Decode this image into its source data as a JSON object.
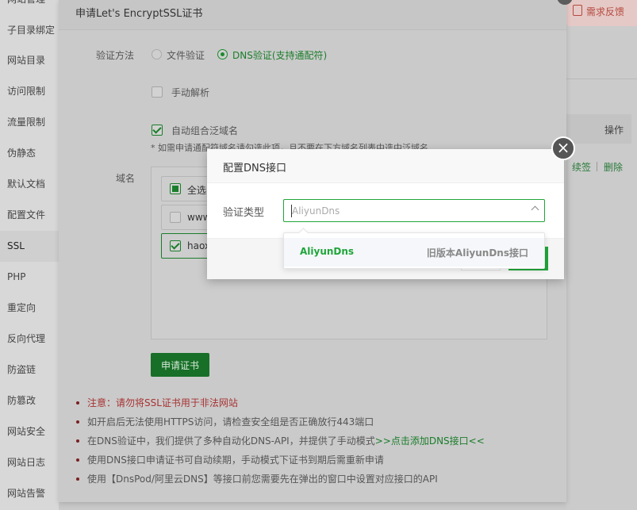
{
  "sidebar": {
    "items": [
      "网站管理",
      "子目录绑定",
      "网站目录",
      "访问限制",
      "流量限制",
      "伪静态",
      "默认文档",
      "配置文件",
      "SSL",
      "PHP",
      "重定向",
      "反向代理",
      "防盗链",
      "防篡改",
      "网站安全",
      "网站日志",
      "网站告警"
    ],
    "active": "SSL"
  },
  "background": {
    "feedback_label": "需求反馈",
    "table_header_action": "操作",
    "row_action_renew": "续签",
    "row_action_delete": "删除"
  },
  "ssl_dialog": {
    "title": "申请Let's EncryptSSL证书",
    "verify_method_label": "验证方法",
    "verify_option_file": "文件验证",
    "verify_option_dns": "DNS验证(支持通配符)",
    "verify_selected": "dns",
    "manual_parse_label": "手动解析",
    "manual_parse_checked": false,
    "auto_wildcard_label": "自动组合泛域名",
    "auto_wildcard_checked": true,
    "wildcard_hint": "* 如需申请通配符域名请勾选此项，且不要在下方域名列表中选中泛域名",
    "domain_label": "域名",
    "domains": [
      {
        "text": "全选",
        "state": "partial"
      },
      {
        "text": "www",
        "state": "unchecked"
      },
      {
        "text": "haox",
        "state": "checked"
      }
    ],
    "apply_button": "申请证书",
    "notes": {
      "warn": "注意：请勿将SSL证书用于非法网站",
      "n1": "如开启后无法使用HTTPS访问，请检查安全组是否正确放行443端口",
      "n2_prefix": "在DNS验证中，我们提供了多种自动化DNS-API，并提供了手动模式",
      "n2_link": ">>点击添加DNS接口<<",
      "n3": "使用DNS接口申请证书可自动续期，手动模式下证书到期后需重新申请",
      "n4": "使用【DnsPod/阿里云DNS】等接口前您需要先在弹出的窗口中设置对应接口的API"
    }
  },
  "dns_modal": {
    "title": "配置DNS接口",
    "close_glyph": "×",
    "type_label": "验证类型",
    "select_placeholder": "AliyunDns",
    "options": [
      {
        "name": "AliyunDns",
        "desc": "旧版本AliyunDns接口"
      }
    ]
  }
}
